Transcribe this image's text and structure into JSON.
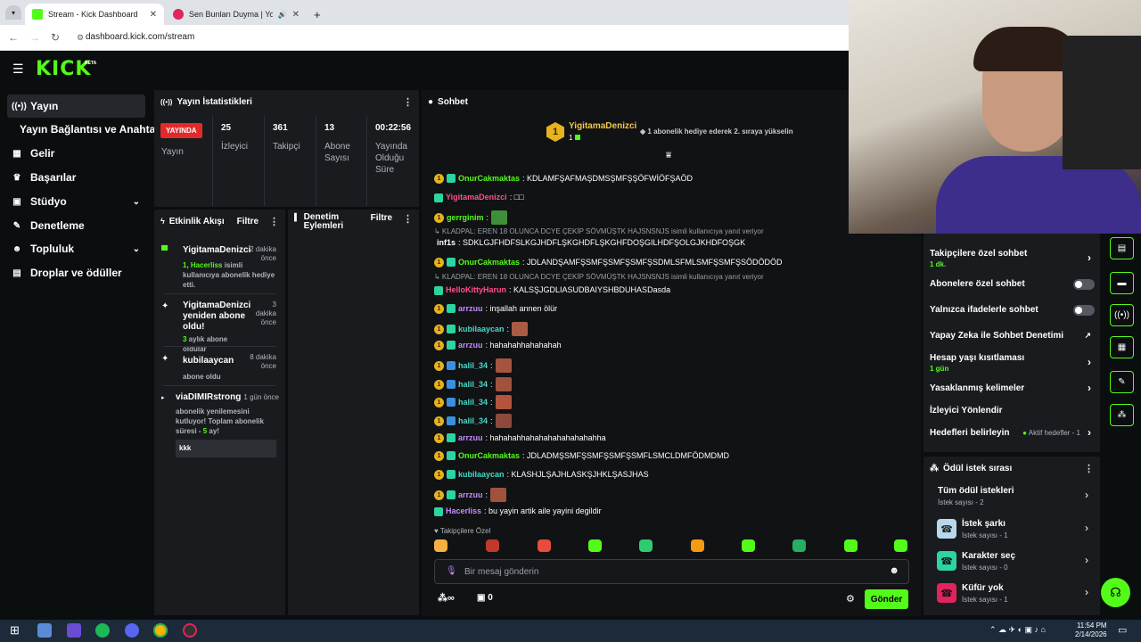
{
  "browser": {
    "tabs": [
      {
        "title": "Stream - Kick Dashboard",
        "color": "#53fc18"
      },
      {
        "title": "Sen Bunları Duyma | YouTube",
        "color": "#e0245e"
      }
    ],
    "new_tab": "+",
    "url": "dashboard.kick.com/stream"
  },
  "header": {
    "logo": "KICK",
    "beta": "BETA"
  },
  "sidebar": {
    "items": [
      {
        "label": "Yayın",
        "icon": "((•))",
        "active": true
      },
      {
        "label": "Yayın Bağlantısı ve Anahtarı",
        "icon": ""
      },
      {
        "label": "Gelir",
        "icon": "▦"
      },
      {
        "label": "Başarılar",
        "icon": "🏆"
      },
      {
        "label": "Stüdyo",
        "icon": "▣",
        "expand": true
      },
      {
        "label": "Denetleme",
        "icon": "🔧"
      },
      {
        "label": "Topluluk",
        "icon": "👥",
        "expand": true
      },
      {
        "label": "Droplar ve ödüller",
        "icon": "▤"
      }
    ]
  },
  "stats": {
    "title": "Yayın İstatistikleri",
    "live_badge": "YAYINDA",
    "live_label": "Yayın",
    "viewers_value": "25",
    "viewers_label": "İzleyici",
    "followers_value": "361",
    "followers_label": "Takipçi",
    "subs_value": "13",
    "subs_label": "Abone Sayısı",
    "duration_value": "00:22:56",
    "duration_label": "Yayında Olduğu Süre"
  },
  "activity": {
    "title": "Etkinlik Akışı",
    "filter": "Filtre",
    "events": [
      {
        "user": "YigitamaDenizci",
        "time": "2 dakika önce",
        "line1": "1, Hacerliss",
        "line2": " isimli kullanıcıya abonelik hediye etti."
      },
      {
        "user": "YigitamaDenizci yeniden abone oldu!",
        "time": "3 dakika önce",
        "line1": "3",
        "line2": " aylık abone oldular"
      },
      {
        "user": "kubilaaycan",
        "time": "8 dakika önce",
        "line1": "",
        "line2": "abone oldu"
      },
      {
        "user": "viaDIMIRstrong",
        "time": "1 gün önce",
        "line1": "abonelik yenilemesini kutluyor! Toplam abonelik süresi - ",
        "line2": "5",
        "line3": " ay!",
        "message": "kkk"
      }
    ]
  },
  "moderation": {
    "title": "Denetim Eylemleri",
    "filter": "Filtre"
  },
  "chat": {
    "title": "Sohbet",
    "pinned_user": "YigitamaDenizci",
    "pinned_count": "1",
    "pinned_text": "1 abonelik hediye ederek 2. sıraya yükselin",
    "messages": [
      {
        "user": "OnurCakmaktas",
        "text": ": KDLAMFŞAFMAŞDMSŞMFŞŞÖFWİÖFŞAÖD",
        "cls": "u-green"
      },
      {
        "user": "YigitamaDenizci",
        "text": ": □□",
        "cls": "u-pink"
      },
      {
        "user": "gerrginim",
        "text": ":",
        "cls": "u-green",
        "emote": true
      },
      {
        "reply": "KLADPAL: EREN 18 OLUNCA DCYE ÇEKİP SÖVMÜŞTK HAJSNSNJS isimli kullanıcıya yanıt veriyor"
      },
      {
        "user": "inf1s",
        "text": ": SDKLGJFHDFSLKGJHDFLŞKGHDFLŞKGHFDOŞGILHDFŞOLGJKHDFOŞGK",
        "cls": "plain"
      },
      {
        "user": "OnurCakmaktas",
        "text": ": JDLANDŞAMFŞSMFŞSMFŞSMFŞSDMLSFMLSMFŞSMFŞSÖDÖDÖD",
        "cls": "u-green"
      },
      {
        "reply": "KLADPAL: EREN 18 OLUNCA DCYE ÇEKİP SÖVMÜŞTK HAJSNSNJS isimli kullanıcıya yanıt veriyor"
      },
      {
        "user": "HelloKittyHarun",
        "text": ": KALSŞJGDLIASUDBAIYSHBDUHASDasda",
        "cls": "u-pink"
      },
      {
        "user": "arrzuu",
        "text": ": inşallah annen ölür",
        "cls": "u-purple"
      },
      {
        "user": "kubilaaycan",
        "text": ":",
        "cls": "u-teal",
        "emote": true
      },
      {
        "user": "arrzuu",
        "text": ": hahahahhahahahah",
        "cls": "u-purple"
      },
      {
        "user": "halil_34",
        "text": ":",
        "cls": "u-teal",
        "emote": true
      },
      {
        "user": "halil_34",
        "text": ":",
        "cls": "u-teal",
        "emote": true
      },
      {
        "user": "halil_34",
        "text": ":",
        "cls": "u-teal",
        "emote": true
      },
      {
        "user": "halil_34",
        "text": ":",
        "cls": "u-teal",
        "emote": true
      },
      {
        "user": "arrzuu",
        "text": ": hahahahhahahahahahahahahha",
        "cls": "u-purple"
      },
      {
        "user": "OnurCakmaktas",
        "text": ": JDLADMŞSMFŞSMFŞSMFŞSMFLSMCLDMFÖDMDMD",
        "cls": "u-green"
      },
      {
        "user": "kubilaaycan",
        "text": ": KLASHJLŞAJHLASKŞJHKLŞASJHAS",
        "cls": "u-teal"
      },
      {
        "user": "arrzuu",
        "text": ":",
        "cls": "u-purple",
        "emote": true
      },
      {
        "user": "Hacerliss",
        "text": ": bu yayin artik aile yayini degildir",
        "cls": "u-purple"
      }
    ],
    "followers_only": "Takipçilere Özel",
    "input_placeholder": "Bir mesaj gönderin",
    "points": "∞",
    "count": "0",
    "send": "Gönder"
  },
  "settings": {
    "rows": [
      {
        "label": "Takipçilere özel sohbet",
        "sub": "1 dk.",
        "type": "chevron"
      },
      {
        "label": "Abonelere özel sohbet",
        "type": "toggle"
      },
      {
        "label": "Yalnızca ifadelerle sohbet",
        "type": "toggle"
      },
      {
        "label": "Yapay Zeka ile Sohbet Denetimi",
        "type": "link"
      },
      {
        "label": "Hesap yaşı kısıtlaması",
        "sub": "1 gün",
        "type": "chevron"
      },
      {
        "label": "Yasaklanmış kelimeler",
        "type": "chevron"
      },
      {
        "label": "İzleyici Yönlendir",
        "type": "none"
      },
      {
        "label": "Hedefleri belirleyin",
        "extra": "Aktif hedefler - 1",
        "type": "chevron"
      }
    ]
  },
  "rewards": {
    "title": "Ödül istek sırası",
    "all": "Tüm ödül istekleri",
    "all_sub": "İstek sayısı - 2",
    "items": [
      {
        "title": "İstek şarkı",
        "sub": "İstek sayısı - 1",
        "color": "#b9d7ea"
      },
      {
        "title": "Karakter seç",
        "sub": "İstek sayısı - 0",
        "color": "#2bd4a0"
      },
      {
        "title": "Küfür yok",
        "sub": "İstek sayısı - 1",
        "color": "#e0245e"
      }
    ]
  },
  "taskbar": {
    "time": "11:54 PM",
    "date": "2/14/2026"
  }
}
